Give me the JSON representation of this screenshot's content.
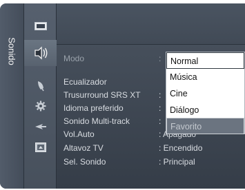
{
  "panel": {
    "tab_label": "Sonido"
  },
  "icons": [
    {
      "name": "picture-icon"
    },
    {
      "name": "sound-icon"
    },
    {
      "name": "channel-icon"
    },
    {
      "name": "setup-icon"
    },
    {
      "name": "input-icon"
    },
    {
      "name": "application-icon"
    }
  ],
  "menu": {
    "rows": [
      {
        "label": "Modo",
        "value": ":"
      },
      {
        "label": "Ecualizador",
        "value": ""
      },
      {
        "label": "Trusurround SRS XT",
        "value": ":"
      },
      {
        "label": "Idioma preferido",
        "value": ":"
      },
      {
        "label": "Sonido Multi-track",
        "value": ":"
      },
      {
        "label": "Vol.Auto",
        "value": ": Apagado"
      },
      {
        "label": "Altavoz TV",
        "value": ": Encendido"
      },
      {
        "label": "Sel. Sonido",
        "value": ": Principal"
      }
    ]
  },
  "dropdown": {
    "options": [
      {
        "label": "Normal"
      },
      {
        "label": "Música"
      },
      {
        "label": "Cine"
      },
      {
        "label": "Diálogo"
      },
      {
        "label": "Favorito"
      }
    ]
  }
}
